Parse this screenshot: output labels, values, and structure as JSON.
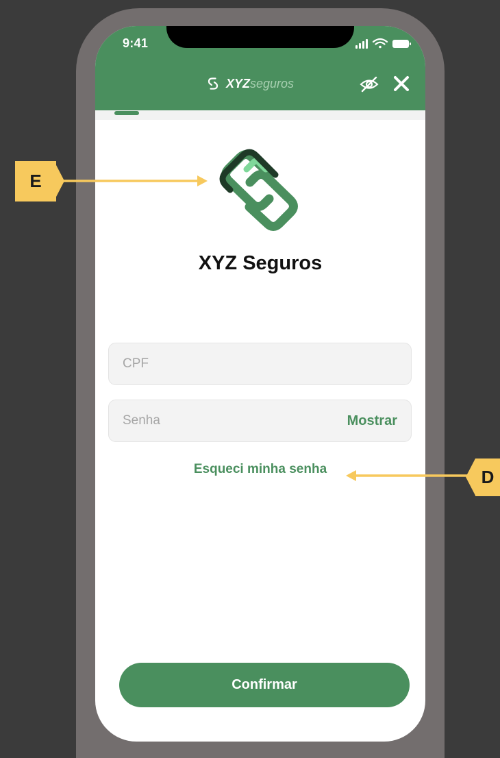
{
  "status_bar": {
    "time": "9:41"
  },
  "header": {
    "brand_bold": "XYZ",
    "brand_light": "seguros",
    "icons": [
      "s-logo-icon",
      "eye-off-icon",
      "close-icon"
    ]
  },
  "progress": {
    "fraction": 0.08
  },
  "login": {
    "company_name": "XYZ Seguros",
    "cpf_placeholder": "CPF",
    "password_placeholder": "Senha",
    "show_label": "Mostrar",
    "forgot_label": "Esqueci minha senha",
    "confirm_label": "Confirmar"
  },
  "annotations": {
    "e_label": "E",
    "d_label": "D"
  },
  "colors": {
    "brand_green": "#4a8f5e",
    "logo_dark": "#1e3a27",
    "logo_light": "#7fd89a",
    "callout_yellow": "#f7c95d",
    "background": "#3b3b3b",
    "frame": "#736e6e"
  }
}
